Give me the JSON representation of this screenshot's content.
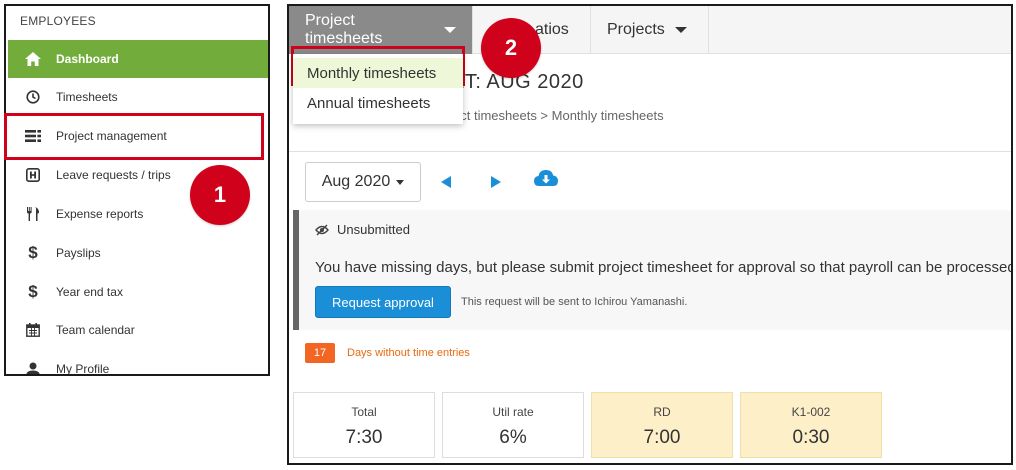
{
  "sidebar": {
    "heading": "EMPLOYEES",
    "items": [
      {
        "label": "Dashboard",
        "icon": "home-icon"
      },
      {
        "label": "Timesheets",
        "icon": "clock-icon"
      },
      {
        "label": "Project management",
        "icon": "list-icon"
      },
      {
        "label": "Leave requests / trips",
        "icon": "luggage-icon"
      },
      {
        "label": "Expense reports",
        "icon": "fork-knife-icon"
      },
      {
        "label": "Payslips",
        "icon": "dollar-icon"
      },
      {
        "label": "Year end tax",
        "icon": "dollar-icon"
      },
      {
        "label": "Team calendar",
        "icon": "calendar-icon"
      },
      {
        "label": "My Profile",
        "icon": "user-icon"
      }
    ]
  },
  "topnav": {
    "tabs": [
      {
        "label": "Project timesheets"
      },
      {
        "label": "atios"
      },
      {
        "label": "Projects"
      }
    ]
  },
  "dropdown": {
    "items": [
      "Monthly timesheets",
      "Annual timesheets"
    ]
  },
  "page": {
    "title": "ET: AUG 2020",
    "breadcrumb": "ect timesheets > Monthly timesheets"
  },
  "toolbar": {
    "month": "Aug 2020"
  },
  "notice": {
    "status": "Unsubmitted",
    "message": "You have missing days, but please submit project timesheet for approval so that payroll can be processed.",
    "button": "Request approval",
    "note": "This request will be sent to Ichirou Yamanashi."
  },
  "missing": {
    "count": "17",
    "label": "Days without time entries"
  },
  "stats": [
    {
      "label": "Total",
      "value": "7:30"
    },
    {
      "label": "Util rate",
      "value": "6%"
    },
    {
      "label": "RD",
      "value": "7:00"
    },
    {
      "label": "K1-002",
      "value": "0:30"
    }
  ],
  "annotations": {
    "marker1": "1",
    "marker2": "2"
  },
  "colors": {
    "active_green": "#72ad3c",
    "primary_blue": "#1a8fd8",
    "highlight_red": "#d0021b",
    "warning_orange": "#f26522"
  }
}
